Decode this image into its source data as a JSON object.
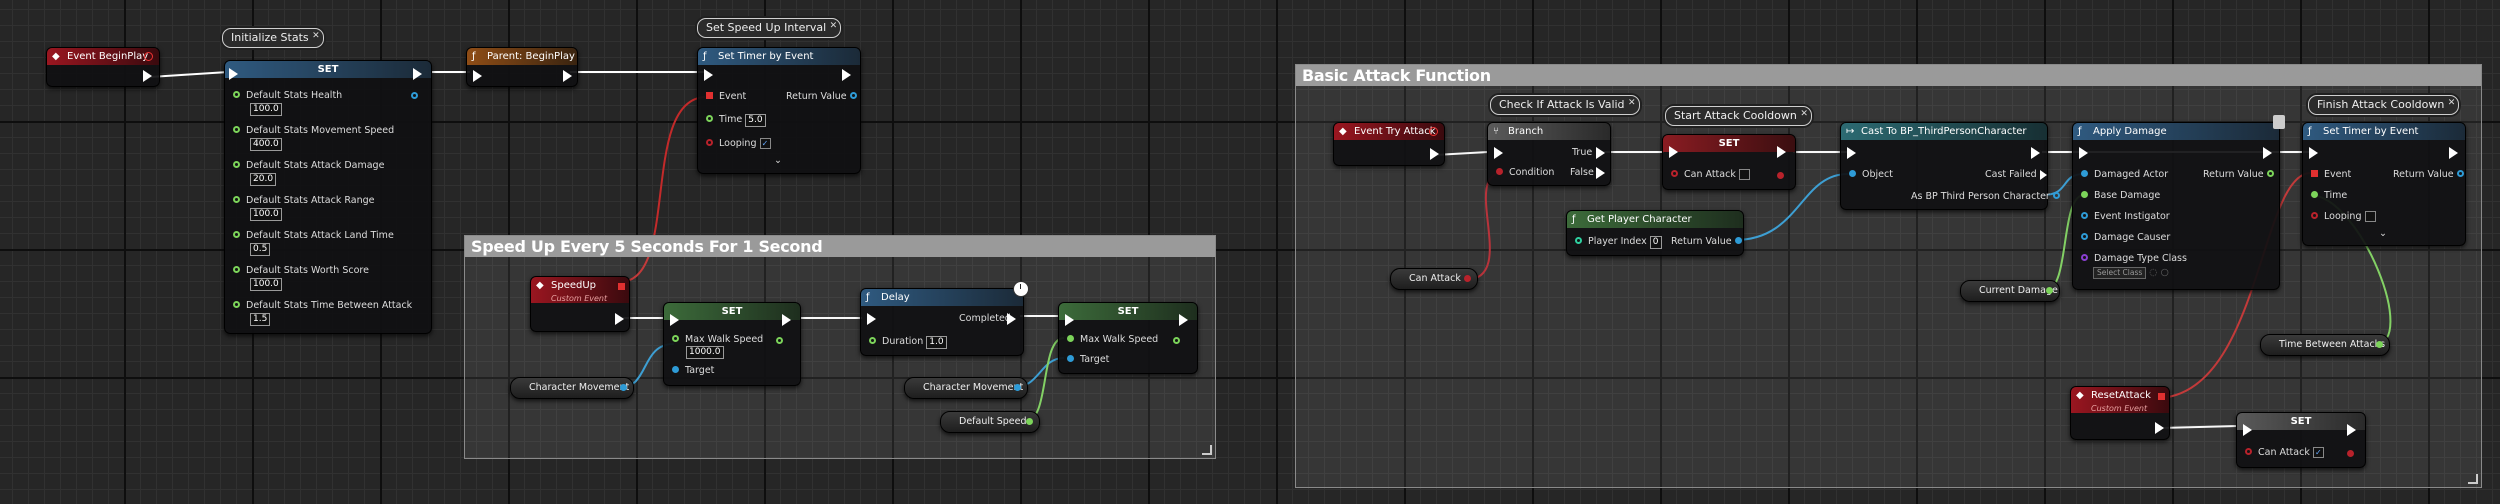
{
  "colors": {
    "exec": "#ffffff",
    "float": "#7cd45a",
    "bool": "#b8222b",
    "object": "#2e9bd6",
    "red_header": "#9a1620",
    "blue_header": "#2f5a80"
  },
  "comments": {
    "speed_up": "Speed Up Every 5 Seconds For 1 Second",
    "basic_attack": "Basic Attack Function"
  },
  "bubbles": {
    "initialize_stats": "Initialize Stats",
    "set_speed_up_interval": "Set Speed Up Interval",
    "check_attack_valid": "Check If Attack Is Valid",
    "start_attack_cooldown": "Start Attack Cooldown",
    "finish_attack_cooldown": "Finish Attack Cooldown"
  },
  "nodes": {
    "begin_play": {
      "title": "Event BeginPlay"
    },
    "set_stats": {
      "title": "SET",
      "pins": [
        {
          "label": "Default Stats Health",
          "value": "100.0"
        },
        {
          "label": "Default Stats Movement Speed",
          "value": "400.0"
        },
        {
          "label": "Default Stats Attack Damage",
          "value": "20.0"
        },
        {
          "label": "Default Stats Attack Range",
          "value": "100.0"
        },
        {
          "label": "Default Stats Attack Land Time",
          "value": "0.5"
        },
        {
          "label": "Default Stats Worth Score",
          "value": "100.0"
        },
        {
          "label": "Default Stats Time Between Attack",
          "value": "1.5"
        }
      ]
    },
    "parent_begin_play": {
      "title": "Parent: BeginPlay"
    },
    "set_timer_1": {
      "title": "Set Timer by Event",
      "event": "Event",
      "return_value": "Return Value",
      "time_label": "Time",
      "time_value": "5.0",
      "looping": "Looping",
      "looping_check": "✓"
    },
    "speed_up": {
      "title": "SpeedUp",
      "subtitle": "Custom Event"
    },
    "set_walk_1": {
      "title": "SET",
      "max_walk_speed": "Max Walk Speed",
      "value": "1000.0",
      "target": "Target"
    },
    "char_movement_1": {
      "label": "Character Movement"
    },
    "delay": {
      "title": "Delay",
      "completed": "Completed",
      "duration": "Duration",
      "duration_value": "1.0"
    },
    "char_movement_2": {
      "label": "Character Movement"
    },
    "set_walk_2": {
      "title": "SET",
      "max_walk_speed": "Max Walk Speed",
      "target": "Target"
    },
    "default_speed": {
      "label": "Default Speed"
    },
    "event_try_attack": {
      "title": "Event Try Attack"
    },
    "branch": {
      "title": "Branch",
      "true_label": "True",
      "condition": "Condition",
      "false_label": "False"
    },
    "set_can_attack_1": {
      "title": "SET",
      "can_attack": "Can Attack"
    },
    "can_attack_var": {
      "label": "Can Attack"
    },
    "get_player_character": {
      "title": "Get Player Character",
      "player_index": "Player Index",
      "player_index_value": "0",
      "return_value": "Return Value"
    },
    "cast": {
      "title": "Cast To BP_ThirdPersonCharacter",
      "object": "Object",
      "cast_failed": "Cast Failed",
      "as_bp": "As BP Third Person Character"
    },
    "apply_damage": {
      "title": "Apply Damage",
      "damaged_actor": "Damaged Actor",
      "return_value": "Return Value",
      "base_damage": "Base Damage",
      "event_instigator": "Event Instigator",
      "damage_causer": "Damage Causer",
      "damage_type_class": "Damage Type Class",
      "select_class": "Select Class"
    },
    "current_damage": {
      "label": "Current Damage"
    },
    "set_timer_2": {
      "title": "Set Timer by Event",
      "event": "Event",
      "return_value": "Return Value",
      "time_label": "Time",
      "looping": "Looping"
    },
    "time_between_attacks": {
      "label": "Time Between Attacks"
    },
    "reset_attack": {
      "title": "ResetAttack",
      "subtitle": "Custom Event"
    },
    "set_can_attack_2": {
      "title": "SET",
      "can_attack": "Can Attack",
      "check": "✓"
    }
  }
}
